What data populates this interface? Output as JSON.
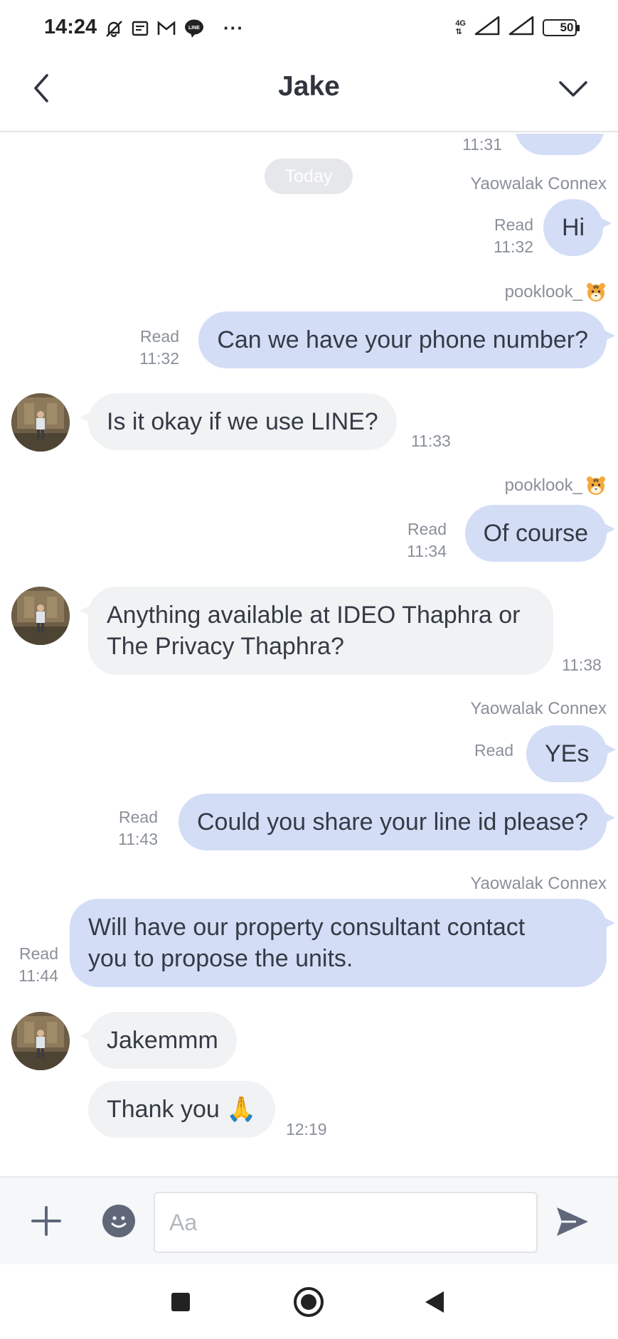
{
  "status_bar": {
    "time": "14:24",
    "network": "4G",
    "battery": "50",
    "battery_level": 0.5,
    "more": "···"
  },
  "header": {
    "title": "Jake"
  },
  "chat": {
    "date_separator": "Today",
    "messages": [
      {
        "direction": "out",
        "sender": "",
        "text": "",
        "read": "",
        "time": "11:31"
      },
      {
        "direction": "out",
        "sender": "Yaowalak Connex",
        "text": "Hi",
        "read": "Read",
        "time": "11:32"
      },
      {
        "direction": "out",
        "sender": "pooklook_",
        "text": "Can we have your phone number?",
        "read": "Read",
        "time": "11:32"
      },
      {
        "direction": "in",
        "text": "Is it okay if we use LINE?",
        "time": "11:33"
      },
      {
        "direction": "out",
        "sender": "pooklook_",
        "text": "Of course",
        "read": "Read",
        "time": "11:34"
      },
      {
        "direction": "in",
        "text": "Anything available at IDEO Thaphra or\nThe Privacy Thaphra?",
        "time": "11:38"
      },
      {
        "direction": "out",
        "sender": "Yaowalak Connex",
        "text": "YEs",
        "read": "Read",
        "time": ""
      },
      {
        "direction": "out",
        "sender": "",
        "text": "Could you share your line id please?",
        "read": "Read",
        "time": "11:43"
      },
      {
        "direction": "out",
        "sender": "Yaowalak Connex",
        "text": "Will have our property consultant contact\nyou to propose the units.",
        "read": "Read",
        "time": "11:44"
      },
      {
        "direction": "in",
        "text": "Jakemmm",
        "time": ""
      },
      {
        "direction": "in",
        "text": "Thank you 🙏",
        "time": "12:19"
      }
    ]
  },
  "input": {
    "placeholder": "Aa",
    "value": ""
  },
  "colors": {
    "outgoing_bubble": "#d3ddf6",
    "incoming_bubble": "#f1f2f4",
    "meta_text": "#8a9099",
    "send_icon": "#5f6779"
  }
}
